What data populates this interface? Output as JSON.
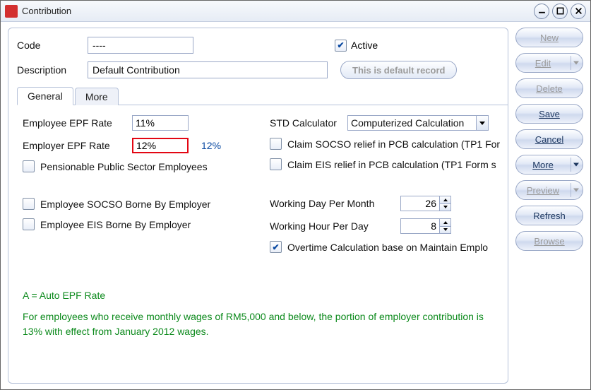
{
  "window": {
    "title": "Contribution"
  },
  "header": {
    "code_label": "Code",
    "code_value": "----",
    "active_label": "Active",
    "active_checked": true,
    "desc_label": "Description",
    "desc_value": "Default Contribution",
    "default_badge": "This is default record"
  },
  "tabs": {
    "general": "General",
    "more": "More"
  },
  "general": {
    "employee_epf_label": "Employee EPF Rate",
    "employee_epf_value": "11%",
    "employer_epf_label": "Employer EPF Rate",
    "employer_epf_value": "12%",
    "employer_epf_hint": "12%",
    "pensionable_label": "Pensionable Public Sector Employees",
    "socso_borne_label": "Employee SOCSO Borne By Employer",
    "eis_borne_label": "Employee EIS Borne By Employer",
    "std_calc_label": "STD Calculator",
    "std_calc_value": "Computerized Calculation",
    "claim_socso_label": "Claim SOCSO relief in PCB calculation (TP1 For",
    "claim_eis_label": "Claim EIS relief in PCB calculation (TP1 Form s",
    "wdpm_label": "Working Day Per Month",
    "wdpm_value": "26",
    "whpd_label": "Working Hour Per Day",
    "whpd_value": "8",
    "ot_calc_label": "Overtime Calculation base on Maintain Emplo"
  },
  "notes": {
    "line1": "A = Auto EPF Rate",
    "line2": "For employees who receive monthly wages of RM5,000 and below, the portion of employer contribution is 13% with effect from January 2012 wages."
  },
  "side": {
    "new": "New",
    "edit": "Edit",
    "delete": "Delete",
    "save": "Save",
    "cancel": "Cancel",
    "more": "More",
    "preview": "Preview",
    "refresh": "Refresh",
    "browse": "Browse"
  }
}
